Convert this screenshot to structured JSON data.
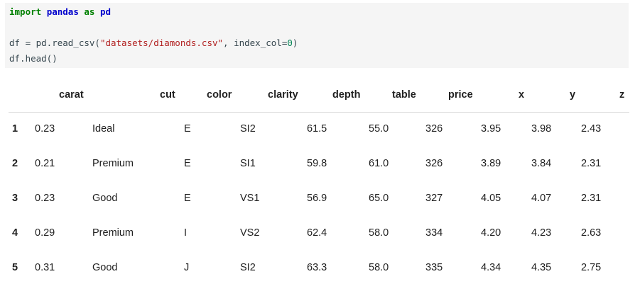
{
  "code": {
    "line1": {
      "kw1": "import",
      "mod1": "pandas",
      "kw2": "as",
      "mod2": "pd"
    },
    "line2": {
      "pre": "df = pd.read_csv(",
      "str": "\"datasets/diamonds.csv\"",
      "mid": ", index_col=",
      "num": "0",
      "post": ")"
    },
    "line3": "df.head()"
  },
  "table": {
    "columns": [
      "carat",
      "cut",
      "color",
      "clarity",
      "depth",
      "table",
      "price",
      "x",
      "y",
      "z"
    ],
    "rows": [
      {
        "index": "1",
        "carat": "0.23",
        "cut": "Ideal",
        "color": "E",
        "clarity": "SI2",
        "depth": "61.5",
        "table": "55.0",
        "price": "326",
        "x": "3.95",
        "y": "3.98",
        "z": "2.43"
      },
      {
        "index": "2",
        "carat": "0.21",
        "cut": "Premium",
        "color": "E",
        "clarity": "SI1",
        "depth": "59.8",
        "table": "61.0",
        "price": "326",
        "x": "3.89",
        "y": "3.84",
        "z": "2.31"
      },
      {
        "index": "3",
        "carat": "0.23",
        "cut": "Good",
        "color": "E",
        "clarity": "VS1",
        "depth": "56.9",
        "table": "65.0",
        "price": "327",
        "x": "4.05",
        "y": "4.07",
        "z": "2.31"
      },
      {
        "index": "4",
        "carat": "0.29",
        "cut": "Premium",
        "color": "I",
        "clarity": "VS2",
        "depth": "62.4",
        "table": "58.0",
        "price": "334",
        "x": "4.20",
        "y": "4.23",
        "z": "2.63"
      },
      {
        "index": "5",
        "carat": "0.31",
        "cut": "Good",
        "color": "J",
        "clarity": "SI2",
        "depth": "63.3",
        "table": "58.0",
        "price": "335",
        "x": "4.34",
        "y": "4.35",
        "z": "2.75"
      }
    ]
  }
}
